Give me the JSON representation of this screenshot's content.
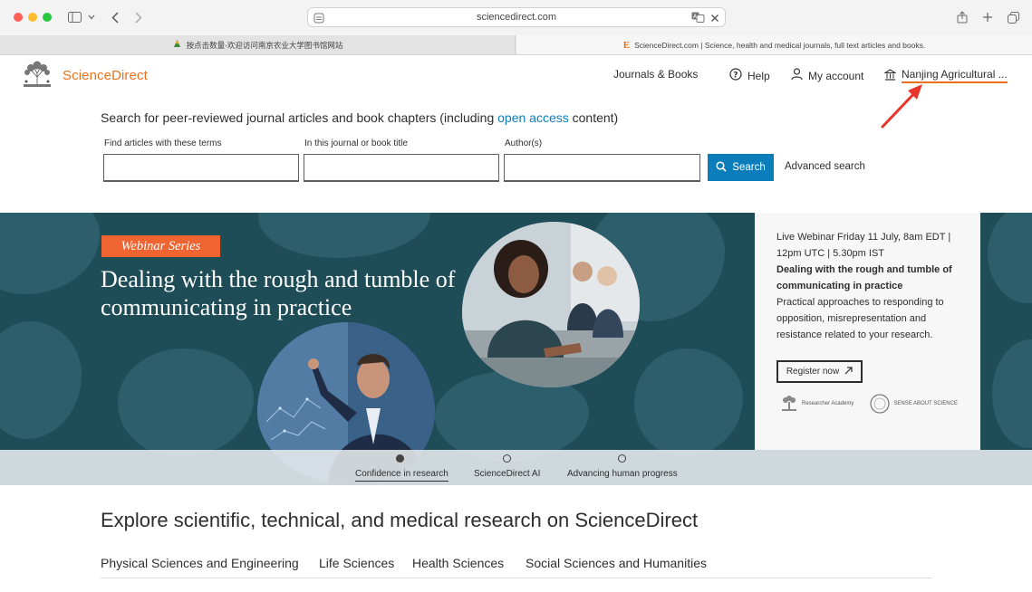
{
  "browser": {
    "url": "sciencedirect.com",
    "tabs": [
      {
        "label": "按点击数量-欢迎访问南京农业大学图书馆网站"
      },
      {
        "label": "ScienceDirect.com | Science, health and medical journals, full text articles and books."
      }
    ]
  },
  "header": {
    "brand": "ScienceDirect",
    "nav": {
      "journals_books": "Journals & Books",
      "help": "Help",
      "my_account": "My account",
      "institution": "Nanjing Agricultural ..."
    }
  },
  "search": {
    "title_pre": "Search for peer-reviewed journal articles and book chapters (including ",
    "title_link": "open access",
    "title_post": " content)",
    "field_terms_label": "Find articles with these terms",
    "field_journal_label": "In this journal or book title",
    "field_author_label": "Author(s)",
    "search_button": "Search",
    "advanced": "Advanced search"
  },
  "banner": {
    "tag": "Webinar Series",
    "headline": "Dealing with the rough and tumble of communicating in practice",
    "info_line1": "Live Webinar Friday 11 July, 8am EDT | 12pm UTC | 5.30pm IST",
    "info_bold": "Dealing with the rough and tumble of communicating in practice",
    "info_desc": "Practical approaches to responding to opposition, misrepresentation and resistance related to your research.",
    "register": "Register now",
    "partner1": "Researcher Academy",
    "partner2": "SENSE ABOUT SCIENCE",
    "carousel": [
      {
        "label": "Confidence in research",
        "active": true
      },
      {
        "label": "ScienceDirect AI",
        "active": false
      },
      {
        "label": "Advancing human progress",
        "active": false
      }
    ]
  },
  "explore": {
    "title": "Explore scientific, technical, and medical research on ScienceDirect",
    "subjects": [
      "Physical Sciences and Engineering",
      "Life Sciences",
      "Health Sciences",
      "Social Sciences and Humanities"
    ]
  },
  "colors": {
    "brand_orange": "#e9711c",
    "link_blue": "#0c7dbb",
    "banner_teal": "#1e4d58",
    "tag_orange": "#f06431",
    "annotation_red": "#e8352a"
  }
}
